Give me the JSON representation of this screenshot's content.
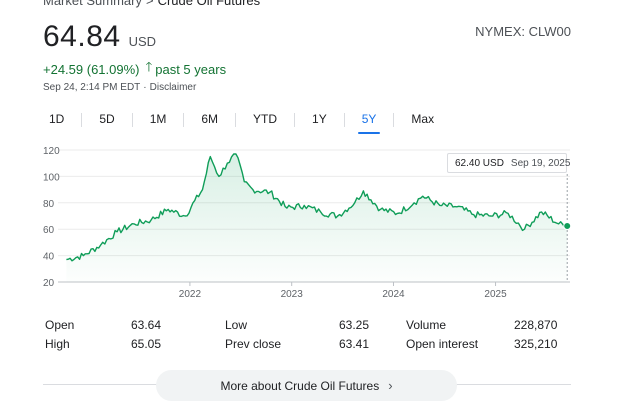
{
  "breadcrumb": {
    "parent": "Market Summary",
    "separator": ">",
    "current": "Crude Oil Futures"
  },
  "quote": {
    "price": "64.84",
    "currency": "USD",
    "ticker": "NYMEX: CLW00"
  },
  "change": {
    "text": "+24.59 (61.09%)",
    "arrow": "🡑",
    "period": "past 5 years"
  },
  "meta": {
    "timestamp": "Sep 24, 2:14 PM EDT",
    "dot": "·",
    "disclaimer": "Disclaimer"
  },
  "range_tabs": [
    "1D",
    "5D",
    "1M",
    "6M",
    "YTD",
    "1Y",
    "5Y",
    "Max"
  ],
  "active_range": "5Y",
  "tooltip": {
    "value": "62.40 USD",
    "date": "Sep 19, 2025"
  },
  "colors": {
    "up": "#137333",
    "accent": "#1a73e8",
    "line": "#0f9d58"
  },
  "chart_data": {
    "type": "area",
    "ylim": [
      20,
      120
    ],
    "yticks": [
      20,
      40,
      60,
      80,
      100,
      120
    ],
    "xticks": [
      "2022",
      "2023",
      "2024",
      "2025"
    ],
    "x": [
      "2020-10",
      "2020-12",
      "2021-02",
      "2021-04",
      "2021-06",
      "2021-08",
      "2021-10",
      "2021-12",
      "2022-02",
      "2022-03",
      "2022-04",
      "2022-05",
      "2022-06",
      "2022-07",
      "2022-08",
      "2022-10",
      "2022-12",
      "2023-02",
      "2023-04",
      "2023-06",
      "2023-08",
      "2023-09",
      "2023-11",
      "2024-01",
      "2024-03",
      "2024-04",
      "2024-06",
      "2024-08",
      "2024-10",
      "2024-12",
      "2025-02",
      "2025-04",
      "2025-06",
      "2025-08",
      "2025-09"
    ],
    "values": [
      37,
      40,
      48,
      58,
      64,
      67,
      75,
      70,
      90,
      115,
      100,
      110,
      117,
      96,
      90,
      88,
      76,
      78,
      73,
      70,
      80,
      89,
      75,
      72,
      80,
      85,
      78,
      77,
      71,
      70,
      72,
      60,
      73,
      64,
      62.4
    ]
  },
  "stats": {
    "open_label": "Open",
    "open": "63.64",
    "high_label": "High",
    "high": "65.05",
    "low_label": "Low",
    "low": "63.25",
    "prev_close_label": "Prev close",
    "prev_close": "63.41",
    "volume_label": "Volume",
    "volume": "228,870",
    "open_interest_label": "Open interest",
    "open_interest": "325,210"
  },
  "more_button": {
    "label": "More about Crude Oil Futures",
    "chevron": "›"
  }
}
